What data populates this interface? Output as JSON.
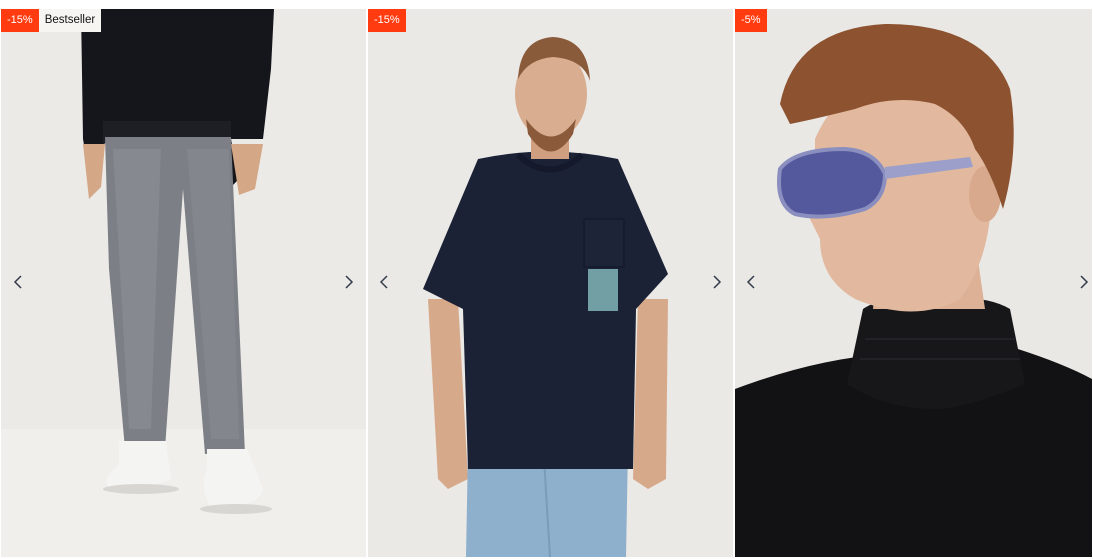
{
  "products": [
    {
      "discount": "-15%",
      "tag": "Bestseller"
    },
    {
      "discount": "-15%"
    },
    {
      "discount": "-5%"
    }
  ],
  "icons": {
    "prev": "chevron-left-icon",
    "next": "chevron-right-icon"
  },
  "colors": {
    "sale_badge": "#ff3b0f",
    "badge_bg": "#f7f5f2",
    "arrow": "#333b4a"
  }
}
